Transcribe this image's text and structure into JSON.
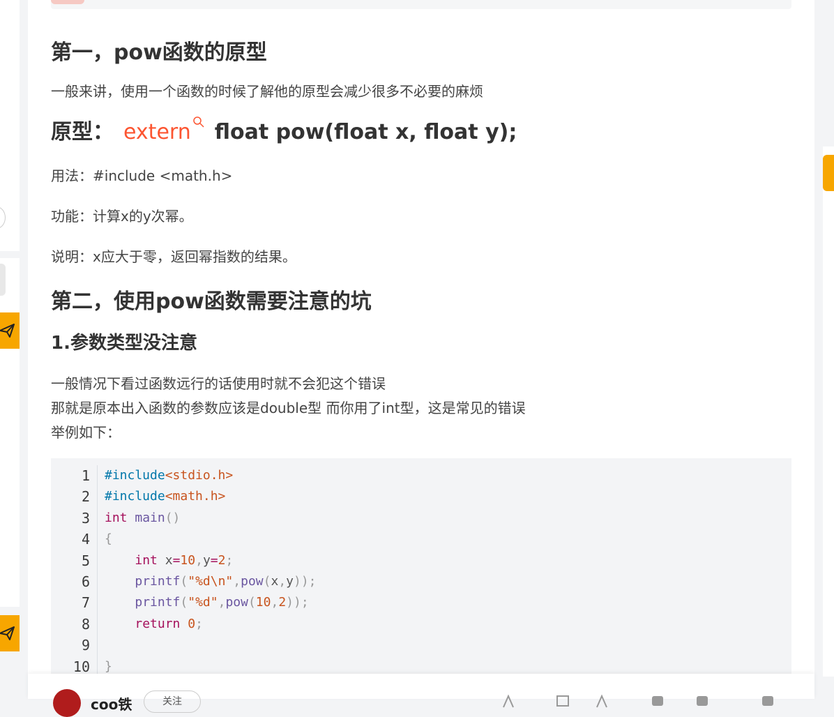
{
  "heading1": "第一，pow函数的原型",
  "intro": "一般来讲，使用一个函数的时候了解他的原型会减少很多不必要的麻烦",
  "prototype": {
    "label": "原型：",
    "keyword": "extern",
    "rest": "float pow(float x, float y);"
  },
  "usage": "用法：#include <math.h>",
  "function": "功能：计算x的y次幂。",
  "description": "说明：x应大于零，返回幂指数的结果。",
  "heading2": "第二，使用pow函数需要注意的坑",
  "subheading1": "1.参数类型没注意",
  "para_lines": [
    "一般情况下看过函数远行的话使用时就不会犯这个错误",
    "那就是原本出入函数的参数应该是double型 而你用了int型，这是常见的错误",
    "举例如下："
  ],
  "code_line_numbers": [
    "1",
    "2",
    "3",
    "4",
    "5",
    "6",
    "7",
    "8",
    "9",
    "10"
  ],
  "code": {
    "l1_a": "#include",
    "l1_b": "<stdio.h>",
    "l2_a": "#include",
    "l2_b": "<math.h>",
    "l3_kw": "int",
    "l3_fn": "main",
    "l3_p": "()",
    "l4": "{",
    "l5_kw": "int",
    "l5_x": "x",
    "l5_eq1": "=",
    "l5_n1": "10",
    "l5_c": ",",
    "l5_y": "y",
    "l5_eq2": "=",
    "l5_n2": "2",
    "l5_semi": ";",
    "l6_fn": "printf",
    "l6_po": "(",
    "l6_str": "\"%d\\n\"",
    "l6_c": ",",
    "l6_fn2": "pow",
    "l6_p2": "(",
    "l6_x": "x",
    "l6_c2": ",",
    "l6_y": "y",
    "l6_end": "));",
    "l7_fn": "printf",
    "l7_po": "(",
    "l7_str": "\"%d\"",
    "l7_c": ",",
    "l7_fn2": "pow",
    "l7_p2": "(",
    "l7_n1": "10",
    "l7_c2": ",",
    "l7_n2": "2",
    "l7_end": "));",
    "l8_kw": "return",
    "l8_n": "0",
    "l8_semi": ";",
    "l10": "}"
  },
  "bottom": {
    "author": "coo铁",
    "follow": "关注"
  },
  "colors": {
    "accent": "#fc5531",
    "sidebar_orange": "#f7a600",
    "code_bg": "#f3f4f6"
  }
}
